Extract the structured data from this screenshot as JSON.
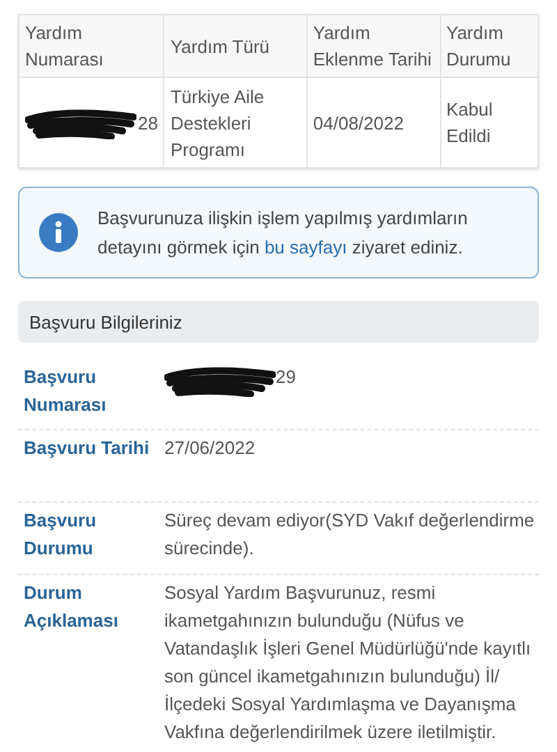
{
  "table": {
    "columns": [
      "Yardım Numarası",
      "Yardım Türü",
      "Yardım Eklenme Tarihi",
      "Yardım Durumu"
    ],
    "rows": [
      {
        "cells": [
          "28",
          "Türkiye Aile Destekleri Programı",
          "04/08/2022",
          "Kabul Edildi"
        ],
        "redacted": true
      }
    ]
  },
  "notice": {
    "text_before": "Başvurunuza ilişkin işlem yapılmış yardımların detayını görmek için",
    "link": "bu sayfayı",
    "text_after": "ziyaret ediniz."
  },
  "section": {
    "title": "Başvuru Bilgileriniz"
  },
  "details": [
    {
      "label": "Başvuru Numarası",
      "value": "29",
      "redacted": true
    },
    {
      "label": "Başvuru Tarihi",
      "value": "27/06/2022",
      "redacted": false
    },
    {
      "label": "Başvuru Durumu",
      "value": "Süreç devam ediyor(SYD Vakıf değerlendirme sürecinde).",
      "redacted": false
    },
    {
      "label": "Durum Açıklaması",
      "value": "Sosyal Yardım Başvurunuz, resmi ikametgahınızın bulunduğu (Nüfus ve Vatandaşlık İşleri Genel Müdürlüğü'nde kayıtlı son güncel ikametgahınızın bulunduğu) İl/ İlçedeki Sosyal Yardımlaşma ve Dayanışma Vakfına değerlendirilmek üzere iletilmiştir.",
      "redacted": false
    }
  ]
}
